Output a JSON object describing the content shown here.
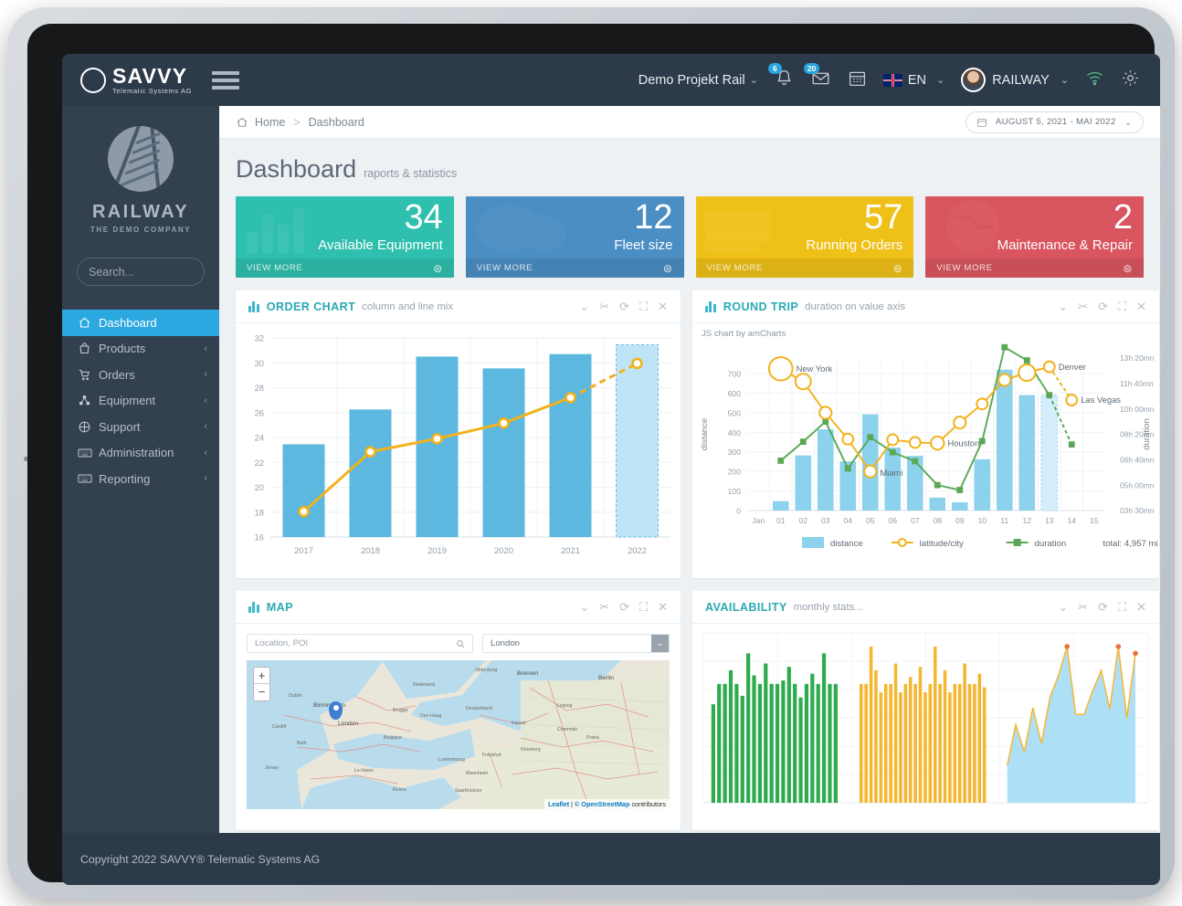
{
  "brand": {
    "logo_name": "SAVVY",
    "logo_sub": "Telematic Systems AG",
    "sidebar_name": "RAILWAY",
    "sidebar_tagline": "THE DEMO COMPANY"
  },
  "topbar": {
    "project": "Demo Projekt Rail",
    "notifications_badge": "6",
    "messages_badge": "20",
    "language": "EN",
    "user": "RAILWAY",
    "icons": [
      "bell-icon",
      "envelope-icon",
      "calendar-icon",
      "wifi-icon",
      "gear-icon"
    ]
  },
  "breadcrumb": {
    "home": "Home",
    "separator": ">",
    "current": "Dashboard",
    "date_range": "AUGUST 5, 2021 - MAI 2022"
  },
  "page": {
    "title": "Dashboard",
    "subtitle": "raports & statistics"
  },
  "sidebar": {
    "search_placeholder": "Search...",
    "items": [
      {
        "label": "Dashboard",
        "icon": "home-icon",
        "active": true,
        "chevron": false
      },
      {
        "label": "Products",
        "icon": "bag-icon",
        "active": false,
        "chevron": true
      },
      {
        "label": "Orders",
        "icon": "cart-icon",
        "active": false,
        "chevron": true
      },
      {
        "label": "Equipment",
        "icon": "nodes-icon",
        "active": false,
        "chevron": true
      },
      {
        "label": "Support",
        "icon": "buoy-icon",
        "active": false,
        "chevron": true
      },
      {
        "label": "Administration",
        "icon": "keyboard-icon",
        "active": false,
        "chevron": true
      },
      {
        "label": "Reporting",
        "icon": "keyboard-icon",
        "active": false,
        "chevron": true
      }
    ]
  },
  "kpis": [
    {
      "value": "34",
      "label": "Available Equipment",
      "action": "VIEW MORE",
      "color": "#2fbfae",
      "art": "bars-icon"
    },
    {
      "value": "12",
      "label": "Fleet size",
      "action": "VIEW MORE",
      "color": "#4b8ec4",
      "art": "clouds-icon"
    },
    {
      "value": "57",
      "label": "Running Orders",
      "action": "VIEW MORE",
      "color": "#efc118",
      "art": "card-icon"
    },
    {
      "value": "2",
      "label": "Maintenance & Repair",
      "action": "VIEW MORE",
      "color": "#d9555f",
      "art": "globe-icon"
    }
  ],
  "panels": {
    "order": {
      "title": "ORDER CHART",
      "subtitle": "column and line mix"
    },
    "round": {
      "title": "ROUND TRIP",
      "subtitle": "duration on value axis",
      "credit": "JS chart by amCharts"
    },
    "map": {
      "title": "MAP",
      "subtitle": "",
      "search_placeholder": "Location, POI",
      "city_value": "London",
      "attribution_leaflet": "Leaflet",
      "attribution_osm": "© OpenStreetMap",
      "attribution_tail": "contributors",
      "zoom_in": "+",
      "zoom_out": "−"
    },
    "availability": {
      "title": "AVAILABILITY",
      "subtitle": "monthly stats..."
    },
    "tools": [
      "chevron-down-icon",
      "settings-icon",
      "refresh-icon",
      "expand-icon",
      "close-icon"
    ]
  },
  "footer": {
    "copyright": "Copyright 2022 SAVVY® Telematic Systems AG"
  },
  "chart_data": [
    {
      "id": "order-chart",
      "type": "bar",
      "title": "ORDER CHART",
      "subtitle": "column and line mix",
      "categories": [
        "2017",
        "2018",
        "2019",
        "2020",
        "2021",
        "2022"
      ],
      "series": [
        {
          "name": "columns",
          "type": "bar",
          "values": [
            23.45,
            26.25,
            30.5,
            29.55,
            30.7,
            31.45
          ],
          "color": "#5cb8de",
          "forecast_index": 5
        },
        {
          "name": "line",
          "type": "line",
          "values": [
            18.05,
            22.85,
            23.9,
            25.15,
            27.2,
            29.95
          ],
          "color": "#f2b21c",
          "dashed_from": 4
        }
      ],
      "ylim": [
        16,
        32
      ],
      "yticks": [
        16,
        18,
        20,
        22,
        24,
        26,
        28,
        30,
        32
      ],
      "xlabel": "",
      "ylabel": "",
      "grid": true,
      "legend": false
    },
    {
      "id": "round-trip",
      "type": "bar",
      "title": "ROUND TRIP",
      "subtitle": "duration on value axis",
      "credit": "JS chart by amCharts",
      "categories": [
        "Jan",
        "01",
        "02",
        "03",
        "04",
        "05",
        "06",
        "07",
        "08",
        "09",
        "10",
        "11",
        "12",
        "13",
        "14",
        "15"
      ],
      "left_axis": {
        "label": "distance",
        "ticks": [
          0,
          100,
          200,
          300,
          400,
          500,
          600,
          700
        ],
        "lim": [
          0,
          780
        ]
      },
      "right_axis": {
        "label": "duration",
        "ticks": [
          "03h 30mn",
          "05h 00mn",
          "06h 40mn",
          "08h 20mn",
          "10h 00mn",
          "11h 40mn",
          "13h 20mn"
        ]
      },
      "series": [
        {
          "name": "distance",
          "type": "bar",
          "color": "#8dd2ec",
          "x": [
            "01",
            "02",
            "03",
            "04",
            "05",
            "06",
            "07",
            "08",
            "09",
            "10",
            "11",
            "12",
            "13"
          ],
          "values": [
            48,
            282,
            415,
            252,
            492,
            322,
            280,
            66,
            42,
            262,
            720,
            590,
            590
          ],
          "forecast_index": 12
        },
        {
          "name": "latitude/city",
          "type": "line",
          "color": "#f2b21c",
          "x": [
            "01",
            "02",
            "03",
            "04",
            "05",
            "06",
            "07",
            "08",
            "09",
            "10",
            "11",
            "12",
            "13",
            "14"
          ],
          "values": [
            725,
            660,
            500,
            365,
            200,
            362,
            348,
            345,
            450,
            545,
            668,
            705,
            735,
            565
          ],
          "bubble_sizes": [
            17,
            10,
            7,
            6,
            7,
            6,
            6,
            8,
            7,
            6,
            7,
            11,
            6,
            6
          ],
          "labels": {
            "01": "New York",
            "05": "Miami",
            "08": "Houston",
            "13": "Denver",
            "14": "Las Vegas"
          },
          "dashed_from": 12
        },
        {
          "name": "duration",
          "type": "line",
          "color": "#5aa856",
          "x": [
            "01",
            "02",
            "03",
            "04",
            "05",
            "06",
            "07",
            "08",
            "09",
            "10",
            "11",
            "12",
            "13",
            "14"
          ],
          "values": [
            255,
            352,
            455,
            215,
            375,
            298,
            252,
            130,
            105,
            355,
            835,
            768,
            590,
            338
          ],
          "dashed_from": 12
        }
      ],
      "legend": [
        {
          "name": "distance",
          "color": "#8dd2ec",
          "marker": "square"
        },
        {
          "name": "latitude/city",
          "color": "#f2b21c",
          "marker": "circle-line"
        },
        {
          "name": "duration",
          "color": "#5aa856",
          "marker": "square-line"
        }
      ],
      "total_label": "total: 4,957 mi"
    },
    {
      "id": "availability",
      "type": "bar",
      "title": "AVAILABILITY",
      "subtitle": "monthly stats...",
      "groups": [
        {
          "name": "group-green",
          "color": "#2eab4f",
          "type": "bar",
          "values": [
            58,
            70,
            70,
            78,
            70,
            63,
            88,
            75,
            70,
            82,
            70,
            70,
            72,
            80,
            70,
            62,
            70,
            76,
            70,
            88,
            70,
            70
          ]
        },
        {
          "name": "group-yellow",
          "color": "#f5b731",
          "type": "bar",
          "values": [
            70,
            70,
            92,
            78,
            65,
            70,
            70,
            82,
            65,
            70,
            74,
            70,
            80,
            65,
            70,
            92,
            70,
            78,
            65,
            70,
            70,
            82,
            70,
            70,
            76,
            68
          ]
        },
        {
          "name": "group-area",
          "color": "#ade0f7",
          "line_color": "#f5b731",
          "type": "area",
          "values": [
            22,
            46,
            30,
            56,
            35,
            62,
            75,
            92,
            52,
            52,
            66,
            78,
            55,
            92,
            50,
            88
          ],
          "peak_markers": [
            7,
            13,
            15
          ],
          "peak_color": "#e8713c"
        }
      ],
      "grid": true,
      "legend": false
    }
  ]
}
